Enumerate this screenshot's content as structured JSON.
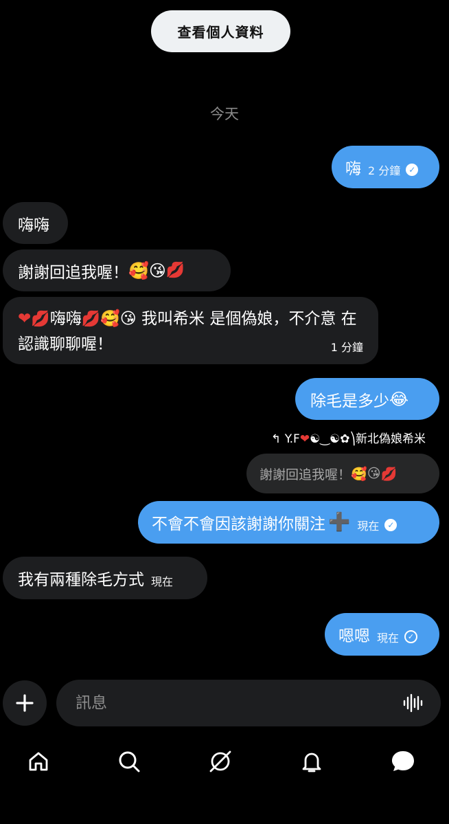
{
  "header": {
    "view_profile_label": "查看個人資料"
  },
  "date_divider": "今天",
  "messages": [
    {
      "text": "嗨",
      "time": "2 分鐘"
    },
    {
      "text": "嗨嗨"
    },
    {
      "text": "謝謝回追我喔！"
    },
    {
      "text_a": "嗨嗨",
      "text_b": "我叫希米 是個偽娘，不介意 在認識聊聊喔！",
      "time": "1 分鐘"
    },
    {
      "text": "除毛是多少"
    },
    {
      "text": "不會不會因該謝謝你關注",
      "time": "現在"
    },
    {
      "text": "我有兩種除毛方式",
      "time": "現在"
    },
    {
      "text": "嗯嗯",
      "time": "現在"
    }
  ],
  "reply": {
    "meta_prefix": "Y.F",
    "meta_suffix": "新北偽娘希米",
    "quote": "謝謝回追我喔！"
  },
  "composer": {
    "placeholder": "訊息"
  },
  "nav": [
    "home-icon",
    "search-icon",
    "explore-icon",
    "notifications-icon",
    "messages-icon"
  ],
  "colors": {
    "outgoing": "#4a9ef0",
    "incoming": "#1d1e20",
    "background": "#000000"
  }
}
